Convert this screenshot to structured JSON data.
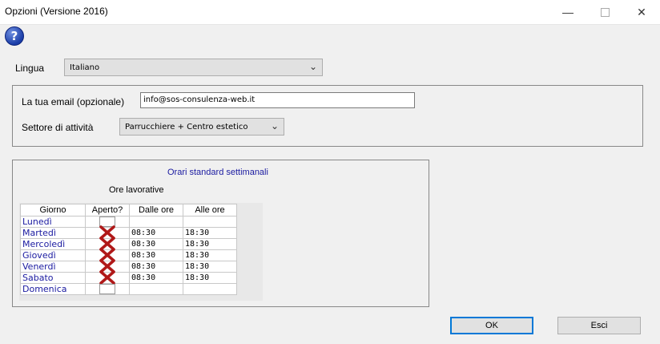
{
  "window": {
    "title": "Opzioni (Versione 2016)"
  },
  "titlebar_icons": [
    "minimize-icon",
    "maximize-icon",
    "close-icon"
  ],
  "help": {
    "glyph": "?"
  },
  "language": {
    "label": "Lingua",
    "selected": "Italiano"
  },
  "email": {
    "label": "La tua email (opzionale)",
    "value": "info@sos-consulenza-web.it"
  },
  "sector": {
    "label": "Settore di attività",
    "selected": "Parrucchiere + Centro estetico"
  },
  "schedule": {
    "title": "Orari standard settimanali",
    "subtitle": "Ore lavorative",
    "columns": [
      "Giorno",
      "Aperto?",
      "Dalle ore",
      "Alle ore"
    ],
    "rows": [
      {
        "day": "Lunedì",
        "open": false,
        "from": "",
        "to": ""
      },
      {
        "day": "Martedì",
        "open": true,
        "from": "08:30",
        "to": "18:30"
      },
      {
        "day": "Mercoledì",
        "open": true,
        "from": "08:30",
        "to": "18:30"
      },
      {
        "day": "Giovedì",
        "open": true,
        "from": "08:30",
        "to": "18:30"
      },
      {
        "day": "Venerdì",
        "open": true,
        "from": "08:30",
        "to": "18:30"
      },
      {
        "day": "Sabato",
        "open": true,
        "from": "08:30",
        "to": "18:30"
      },
      {
        "day": "Domenica",
        "open": false,
        "from": "",
        "to": ""
      }
    ]
  },
  "buttons": {
    "ok": "OK",
    "cancel": "Esci"
  },
  "colors": {
    "link_blue": "#1a1aa0",
    "check_red": "#b01818",
    "default_border": "#0078d7"
  }
}
